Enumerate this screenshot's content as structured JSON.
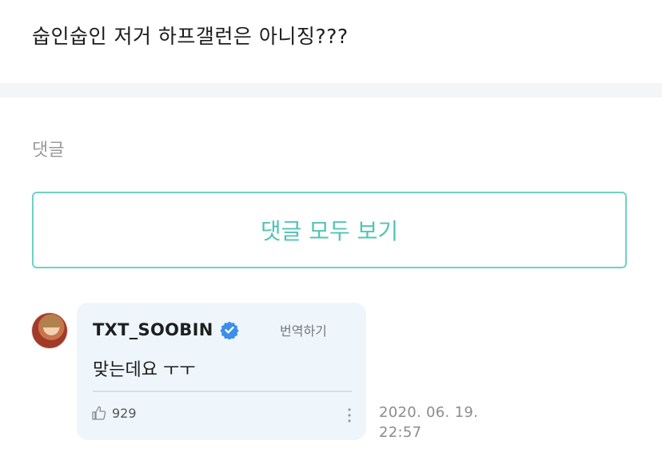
{
  "post": {
    "text": "숩인숩인 저거 하프갤런은 아니징???"
  },
  "comments_section": {
    "title": "댓글",
    "view_all_label": "댓글 모두 보기"
  },
  "comment": {
    "author": "TXT_SOOBIN",
    "verified_icon": "verified-badge",
    "translate_label": "번역하기",
    "text": "맞는데요 ㅜㅜ",
    "likes": "929",
    "date": "2020. 06. 19.",
    "time": "22:57"
  },
  "colors": {
    "accent": "#52c4b4",
    "card_bg": "#eef6fc",
    "verified": "#3d8ee8"
  }
}
